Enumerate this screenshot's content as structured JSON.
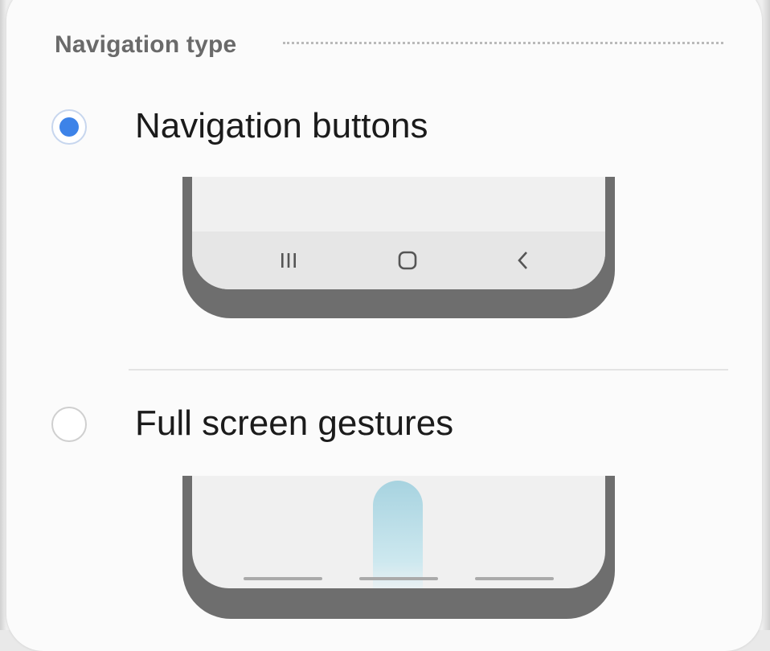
{
  "section": {
    "title": "Navigation type"
  },
  "options": [
    {
      "label": "Navigation buttons",
      "selected": true,
      "preview": {
        "keys": [
          "recents-icon",
          "home-icon",
          "back-icon"
        ]
      }
    },
    {
      "label": "Full screen gestures",
      "selected": false,
      "preview": {
        "gesture_hints": 3
      }
    }
  ],
  "colors": {
    "accent": "#3d83e8",
    "section_title": "#6a6a6a",
    "label": "#1b1b1b",
    "phone_frame": "#6e6e6e",
    "swipe_hint": "#a7d3e0"
  }
}
